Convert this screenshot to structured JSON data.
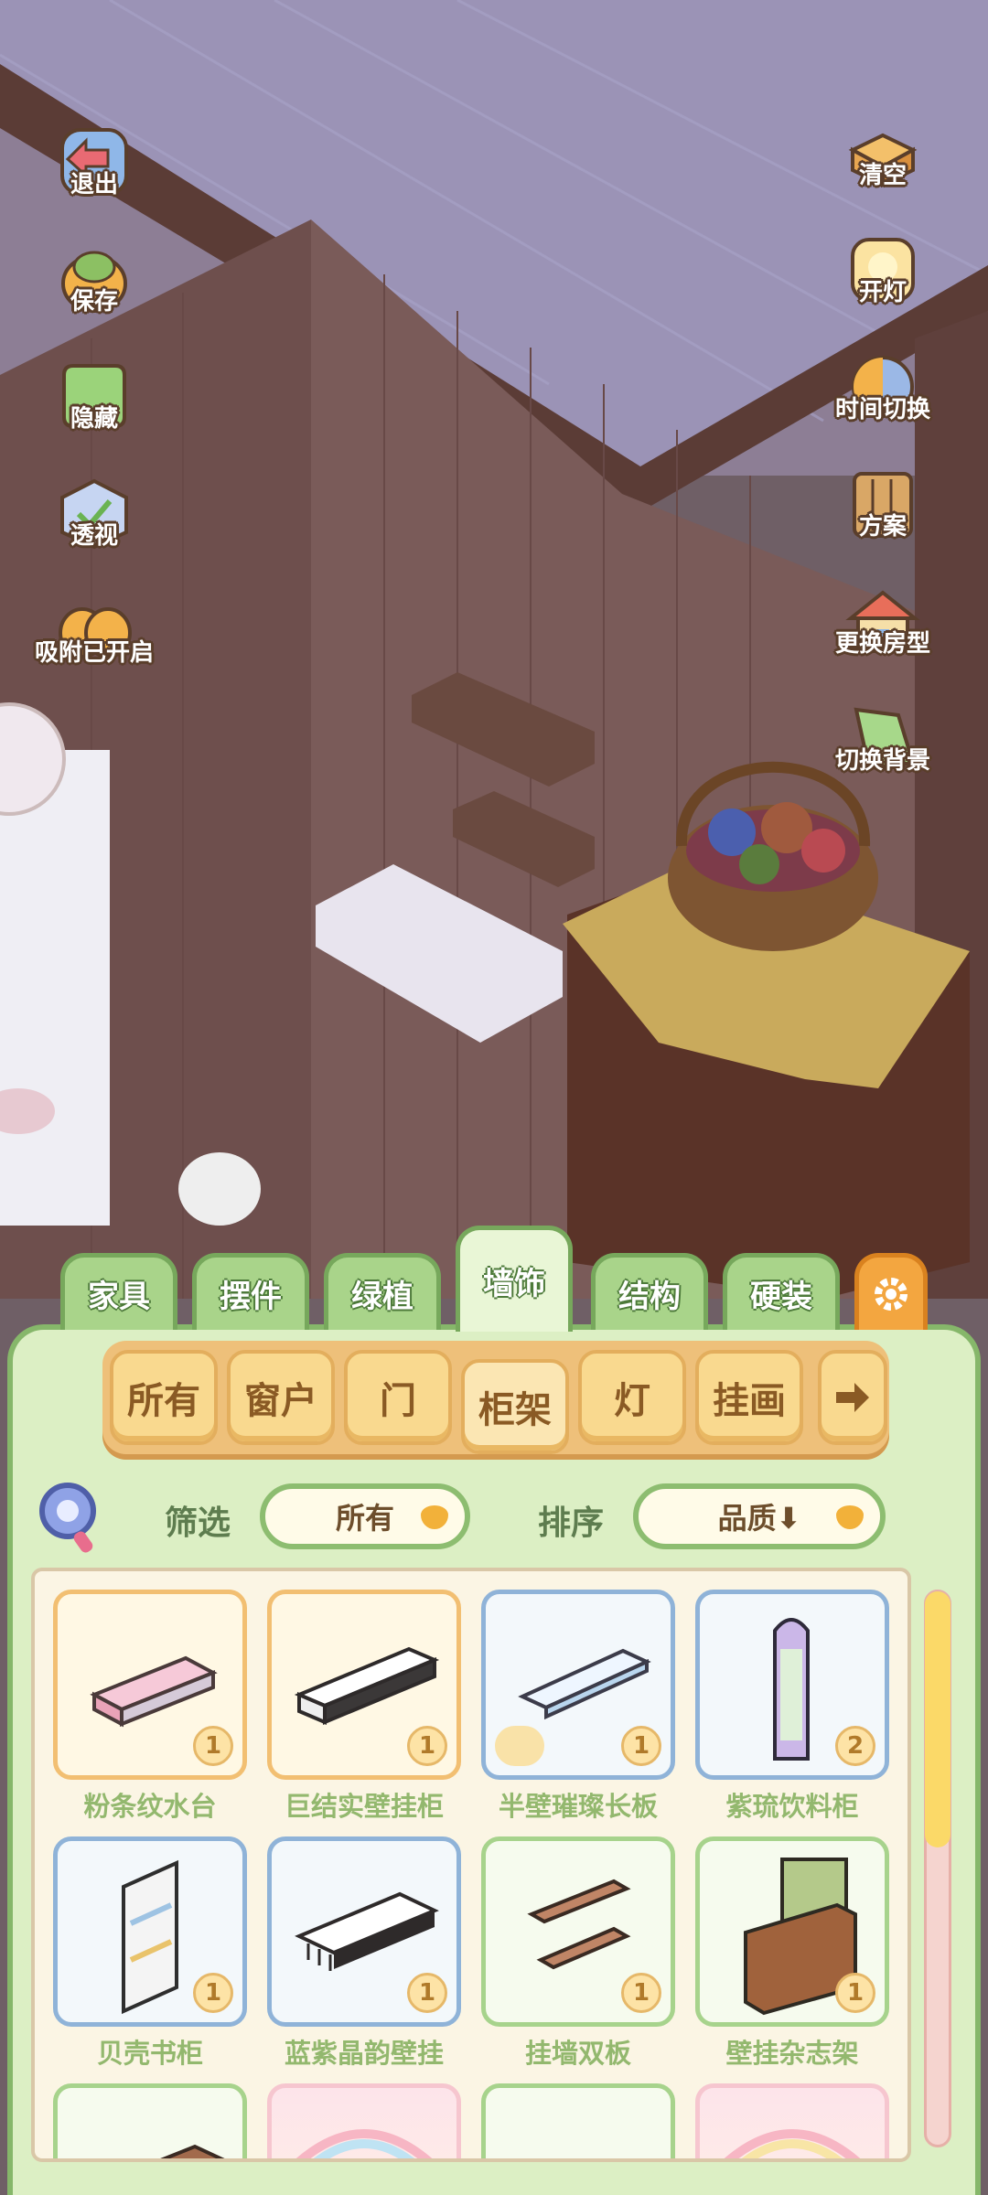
{
  "left_buttons": [
    {
      "label": "退出",
      "icon": "exit-arrow-icon"
    },
    {
      "label": "保存",
      "icon": "save-chick-icon"
    },
    {
      "label": "隐藏",
      "icon": "hide-icon"
    },
    {
      "label": "透视",
      "icon": "perspective-cube-icon"
    },
    {
      "label": "吸附已开启",
      "icon": "snap-chicks-icon"
    }
  ],
  "right_buttons": [
    {
      "label": "清空",
      "icon": "clear-box-icon"
    },
    {
      "label": "开灯",
      "icon": "light-icon"
    },
    {
      "label": "时间切换",
      "icon": "sun-moon-icon"
    },
    {
      "label": "方案",
      "icon": "plan-book-icon"
    },
    {
      "label": "更换房型",
      "icon": "house-icon"
    },
    {
      "label": "切换背景",
      "icon": "background-icon"
    }
  ],
  "category_tabs": [
    "家具",
    "摆件",
    "绿植",
    "墙饰",
    "结构",
    "硬装"
  ],
  "active_category": "墙饰",
  "sub_tabs": [
    "所有",
    "窗户",
    "门",
    "柜架",
    "灯",
    "挂画"
  ],
  "active_sub_tab": "柜架",
  "filter": {
    "label": "筛选",
    "value": "所有"
  },
  "sort": {
    "label": "排序",
    "value": "品质⬇"
  },
  "items": [
    {
      "name": "粉条纹水台",
      "count": "1",
      "style": "gold"
    },
    {
      "name": "巨结实壁挂柜",
      "count": "1",
      "style": "gold"
    },
    {
      "name": "半壁璀璨长板",
      "count": "1",
      "style": "blue",
      "light": true
    },
    {
      "name": "紫琉饮料柜",
      "count": "2",
      "style": "blue"
    },
    {
      "name": "贝壳书柜",
      "count": "1",
      "style": "blue"
    },
    {
      "name": "蓝紫晶韵壁挂",
      "count": "1",
      "style": "blue"
    },
    {
      "name": "挂墙双板",
      "count": "1",
      "style": "green"
    },
    {
      "name": "壁挂杂志架",
      "count": "1",
      "style": "green"
    },
    {
      "name": "",
      "count": "",
      "style": "green"
    },
    {
      "name": "",
      "count": "",
      "style": "rainbow"
    },
    {
      "name": "",
      "count": "",
      "style": "green"
    },
    {
      "name": "",
      "count": "",
      "style": "rainbow"
    }
  ],
  "colors": {
    "panel": "#dcefc4",
    "panel_border": "#86b76a",
    "tab": "#a9d48a",
    "subtab": "#f9d98f",
    "accent": "#f2b13a"
  }
}
